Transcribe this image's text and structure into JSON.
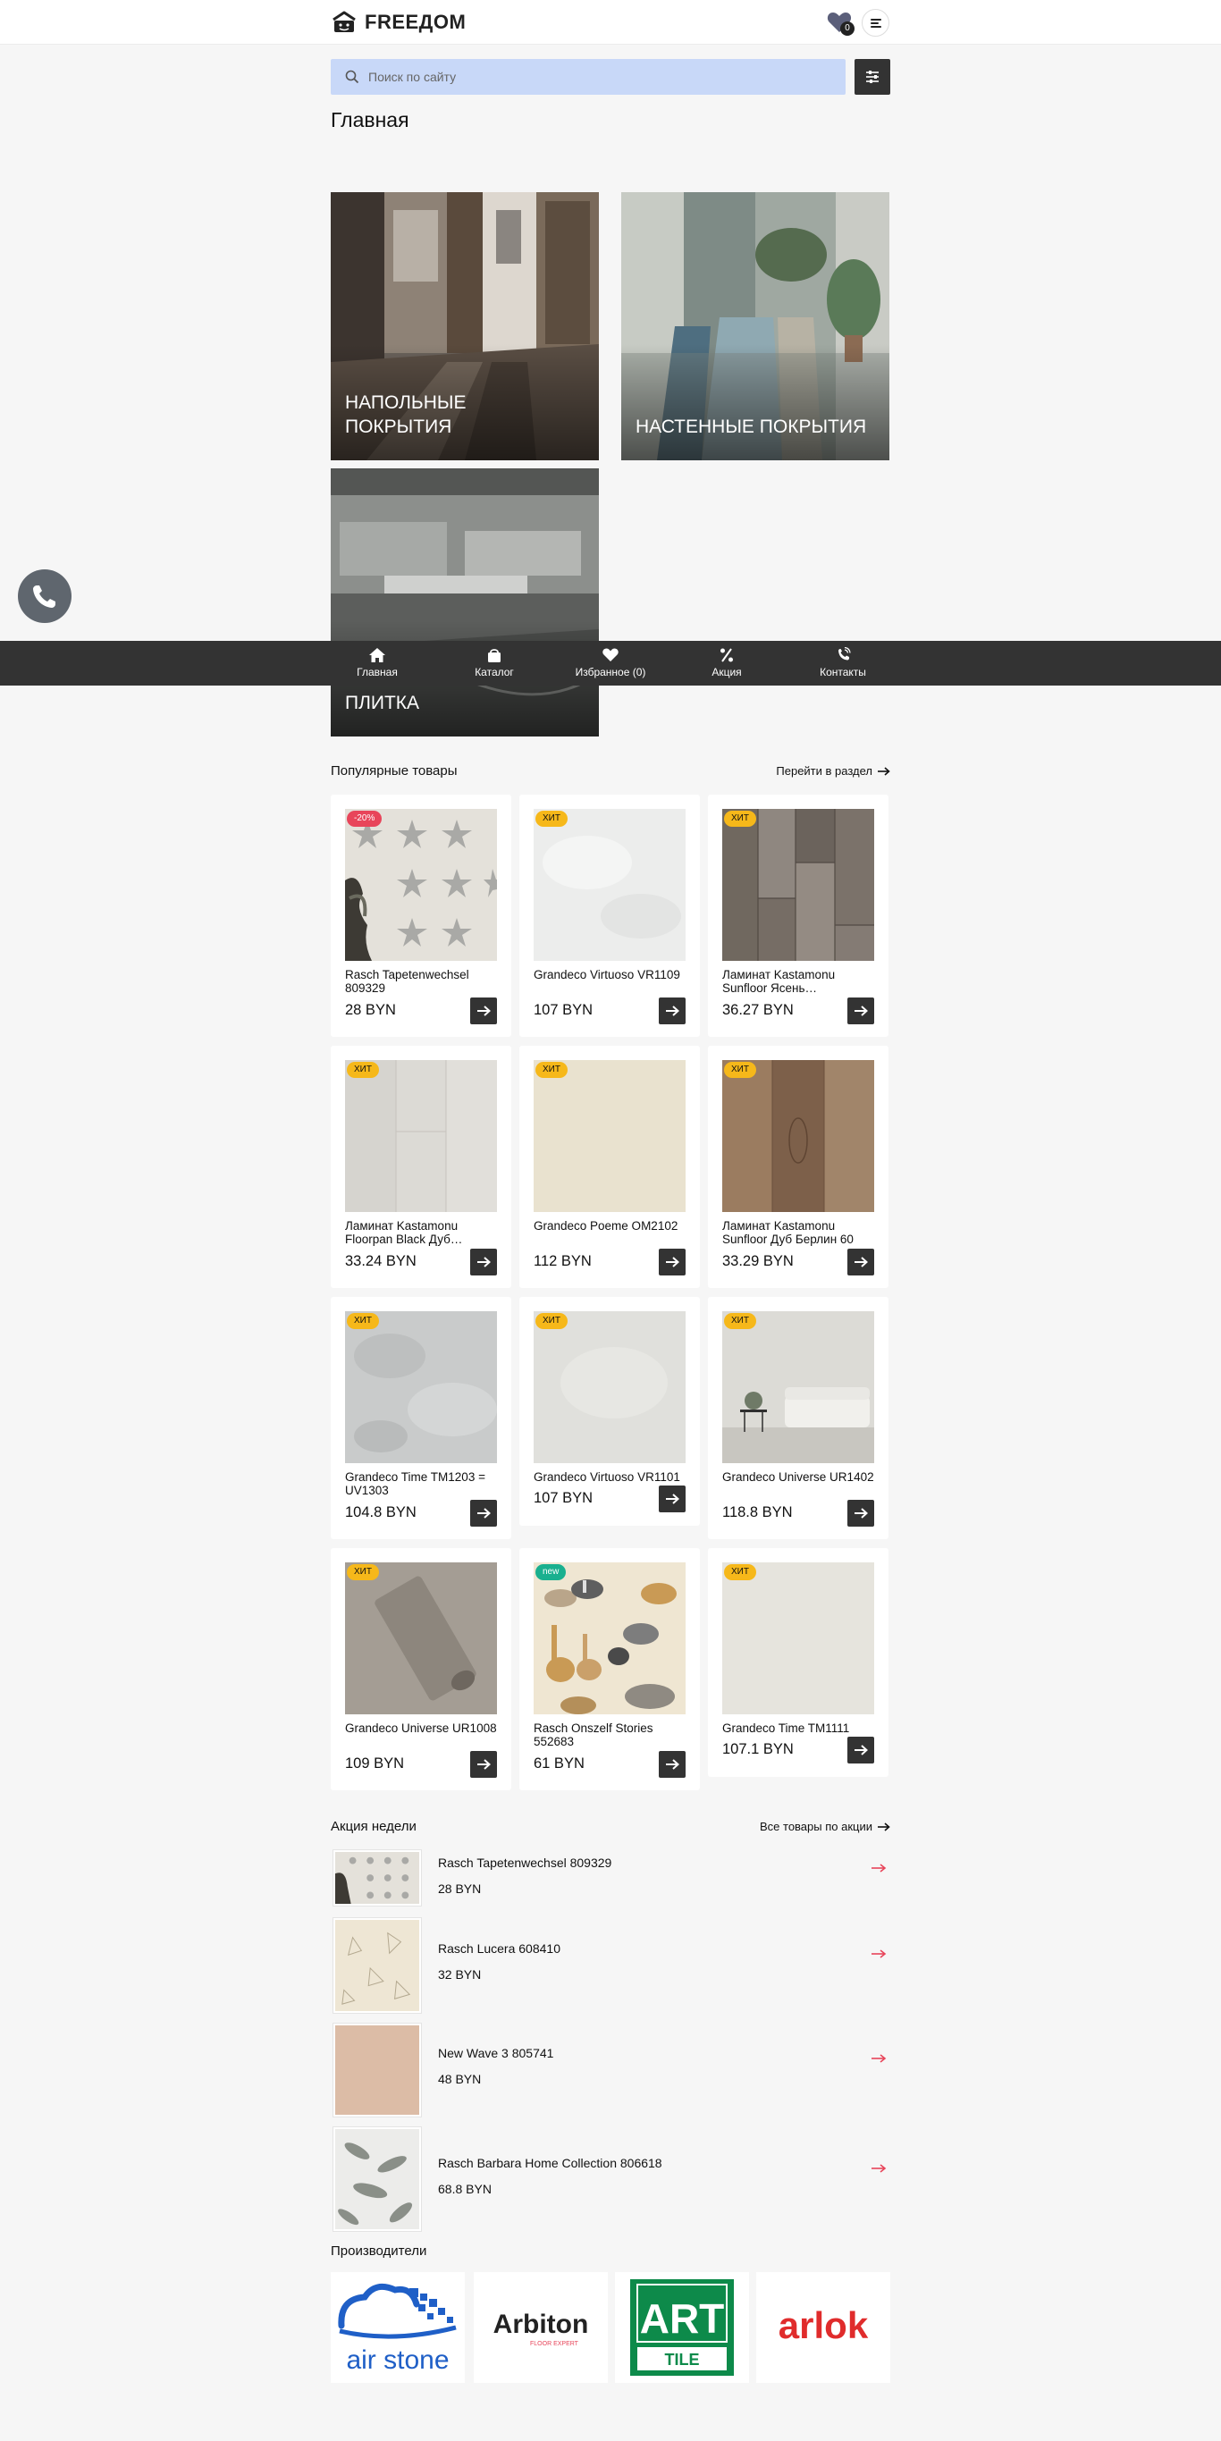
{
  "header": {
    "logo_text": "FREEДОМ",
    "favorites_count": "0",
    "menu_icon": "menu-icon",
    "fav_icon": "heart-icon"
  },
  "search": {
    "placeholder": "Поиск по сайту"
  },
  "page_title": "Главная",
  "categories": [
    {
      "label": "НАПОЛЬНЫЕ ПОКРЫТИЯ"
    },
    {
      "label": "НАСТЕННЫЕ ПОКРЫТИЯ"
    },
    {
      "label": "ПЛИТКА"
    }
  ],
  "bottom_nav": [
    {
      "label": "Главная",
      "icon": "home-icon"
    },
    {
      "label": "Каталог",
      "icon": "bag-icon"
    },
    {
      "label": "Избранное (0)",
      "icon": "heart-icon"
    },
    {
      "label": "Акция",
      "icon": "percent-icon"
    },
    {
      "label": "Контакты",
      "icon": "phone-icon"
    }
  ],
  "popular": {
    "title": "Популярные товары",
    "more": "Перейти в раздел",
    "products": [
      {
        "tag": "-20%",
        "tag_type": "sale",
        "name": " Rasch Tapetenwechsel 809329",
        "price": "28 BYN"
      },
      {
        "tag": "ХИТ",
        "tag_type": "hit",
        "name": "Grandeco Virtuoso VR1109",
        "price": "107 BYN"
      },
      {
        "tag": "ХИТ",
        "tag_type": "hit",
        "name": "Ламинат Kastamonu Sunfloor Ясень…",
        "price": "36.27 BYN"
      },
      {
        "tag": "ХИТ",
        "tag_type": "hit",
        "name": "Ламинат Kastamonu Floorpan Black Дуб…",
        "price": "33.24 BYN"
      },
      {
        "tag": "ХИТ",
        "tag_type": "hit",
        "name": "Grandeco Poeme OM2102",
        "price": "112 BYN"
      },
      {
        "tag": "ХИТ",
        "tag_type": "hit",
        "name": "Ламинат Kastamonu Sunfloor Дуб Берлин 60",
        "price": "33.29 BYN"
      },
      {
        "tag": "ХИТ",
        "tag_type": "hit",
        "name": "Grandeco Time TM1203 = UV1303",
        "price": "104.8 BYN"
      },
      {
        "tag": "ХИТ",
        "tag_type": "hit",
        "name": "Grandeco Virtuoso VR1101",
        "price": "107 BYN"
      },
      {
        "tag": "ХИТ",
        "tag_type": "hit",
        "name": "Grandeco Universe UR1402",
        "price": "118.8 BYN"
      },
      {
        "tag": "ХИТ",
        "tag_type": "hit",
        "name": "Grandeco Universe UR1008",
        "price": "109 BYN"
      },
      {
        "tag": "new",
        "tag_type": "new",
        "name": "Rasch Onszelf Stories 552683",
        "price": "61 BYN"
      },
      {
        "tag": "ХИТ",
        "tag_type": "hit",
        "name": "Grandeco Time TM1111",
        "price": "107.1 BYN"
      }
    ]
  },
  "deals": {
    "title": "Акция недели",
    "more": "Все товары по акции",
    "items": [
      {
        "name": " Rasch Tapetenwechsel 809329",
        "price": "28 BYN"
      },
      {
        "name": "Rasch Lucera 608410",
        "price": "32 BYN"
      },
      {
        "name": "New Wave 3 805741",
        "price": "48 BYN"
      },
      {
        "name": "Rasch Barbara Home Collection 806618",
        "price": "68.8 BYN"
      }
    ]
  },
  "brands": {
    "title": "Производители",
    "items": [
      {
        "name": "air stone"
      },
      {
        "name": "Arbiton",
        "sub": "FLOOR EXPERT"
      },
      {
        "name": "ART",
        "sub": "TILE"
      },
      {
        "name": "arlok"
      }
    ]
  },
  "colors": {
    "dark": "#333333",
    "search_bg": "#c8d8f8",
    "hit": "#f6b81a",
    "sale": "#e8455a",
    "new": "#1ab08f",
    "deal_arrow": "#e8455a"
  }
}
